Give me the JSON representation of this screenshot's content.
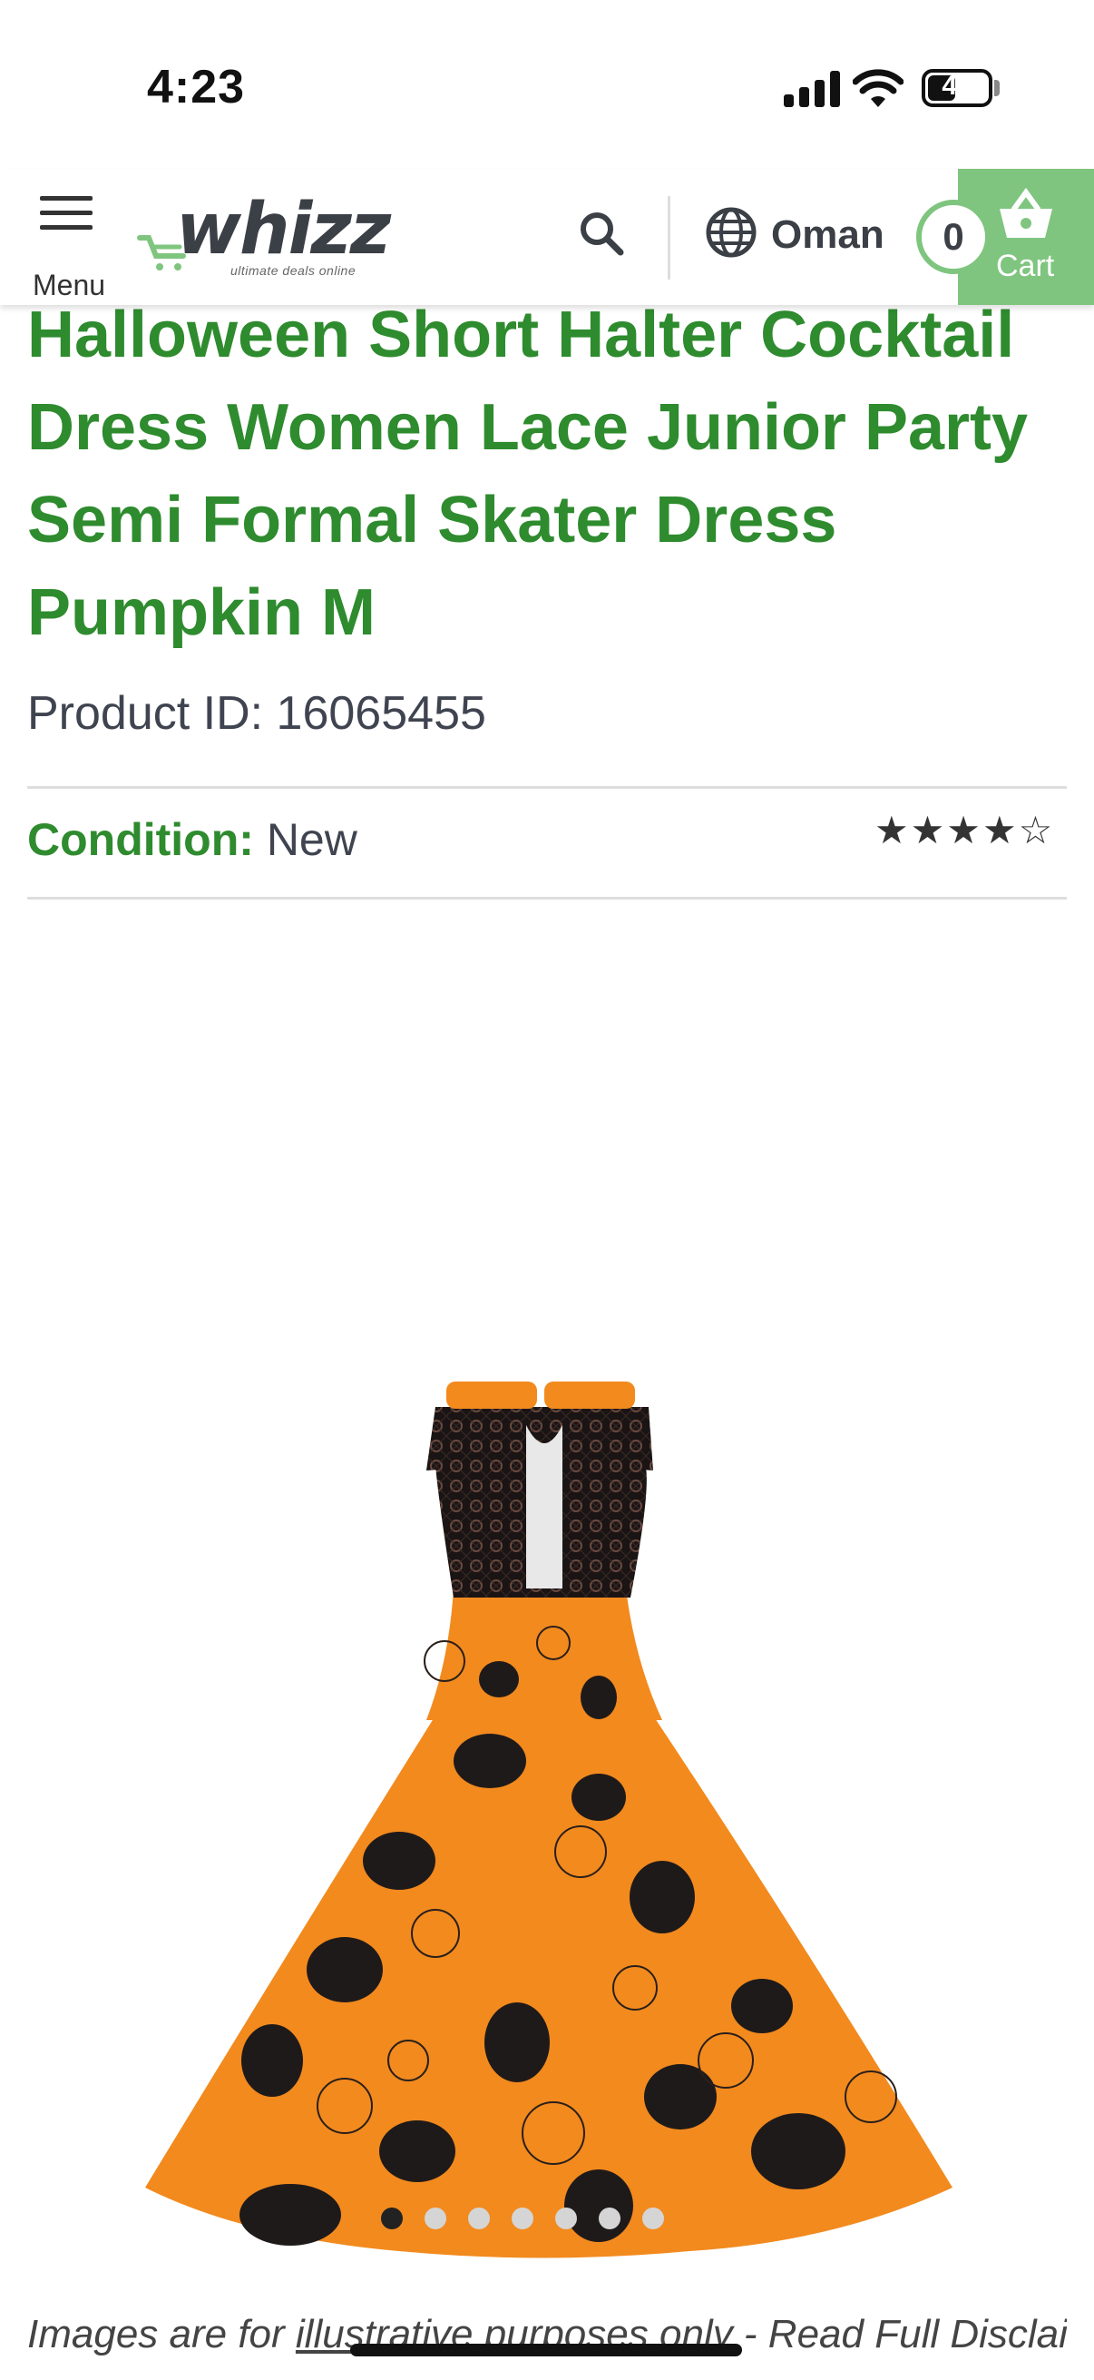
{
  "status_bar": {
    "time": "4:23",
    "battery_level": "44"
  },
  "header": {
    "menu_label": "Menu",
    "logo_text": "whizz",
    "logo_tagline": "ultimate deals online",
    "country": "Oman",
    "cart_count": "0",
    "cart_label": "Cart",
    "accent_color": "#7fc57f"
  },
  "product": {
    "title": "Halloween Short Halter Cocktail Dress Women Lace Junior Party Semi Formal Skater Dress Pumpkin M",
    "id_label": "Product ID: 16065455",
    "condition_label": "Condition:",
    "condition_value": "New",
    "rating_stars": 4,
    "rating_max": 5,
    "rating_glyphs": "★★★★☆",
    "image_icon": "orange-halloween-dress-image",
    "carousel_count": 7,
    "carousel_active": 1,
    "title_color": "#2e8b2e"
  },
  "disclaimer": {
    "prefix": "Images are for ",
    "link": "illustrative purposes",
    "suffix": " only - Read Full Disclaimer"
  }
}
